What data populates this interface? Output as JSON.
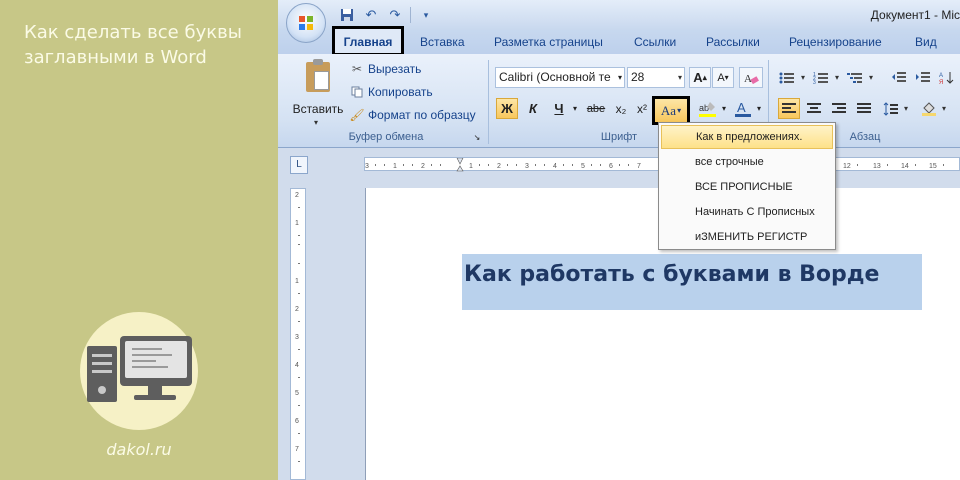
{
  "banner": {
    "title": "Как сделать все буквы заглавными в Word",
    "site": "dakol.ru"
  },
  "window": {
    "title": "Документ1 - Mic"
  },
  "tabs": [
    {
      "label": "Главная"
    },
    {
      "label": "Вставка"
    },
    {
      "label": "Разметка страницы"
    },
    {
      "label": "Ссылки"
    },
    {
      "label": "Рассылки"
    },
    {
      "label": "Рецензирование"
    },
    {
      "label": "Вид"
    }
  ],
  "clipboard": {
    "paste": "Вставить",
    "cut": "Вырезать",
    "copy": "Копировать",
    "format_painter": "Формат по образцу",
    "group_label": "Буфер обмена"
  },
  "font": {
    "name": "Calibri (Основной те",
    "size": "28",
    "group_label": "Шрифт",
    "bold": "Ж",
    "italic": "К",
    "underline": "Ч",
    "strike": "abe",
    "subscript": "x₂",
    "superscript": "x²",
    "change_case": "Aa",
    "grow": "A",
    "shrink": "A"
  },
  "paragraph": {
    "group_label": "Абзац"
  },
  "case_menu": [
    {
      "label": "Как в предложениях."
    },
    {
      "label": "все строчные"
    },
    {
      "label": "ВСЕ ПРОПИСНЫЕ"
    },
    {
      "label": "Начинать С Прописных"
    },
    {
      "label": "иЗМЕНИТЬ РЕГИСТР"
    }
  ],
  "document": {
    "text": "Как работать с буквами в Ворде"
  },
  "colors": {
    "highlight_selected": "#fde189",
    "selection": "#b9d1ec",
    "accent": "#15428b"
  }
}
